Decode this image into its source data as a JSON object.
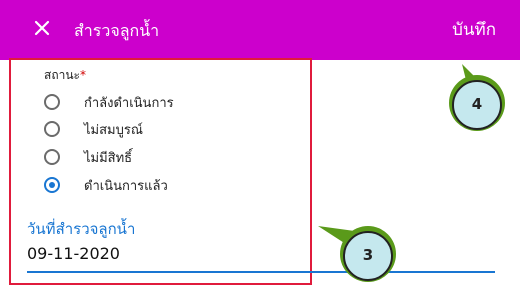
{
  "appbar": {
    "close_icon": "close-icon",
    "title": "สำรวจลูกน้ำ",
    "save_label": "บันทึก",
    "color": "#cc00cc"
  },
  "form": {
    "status": {
      "label": "สถานะ",
      "required_mark": "*",
      "options": [
        {
          "label": "กำลังดำเนินการ",
          "selected": false
        },
        {
          "label": "ไม่สมบูรณ์",
          "selected": false
        },
        {
          "label": "ไม่มีสิทธิ์",
          "selected": false
        },
        {
          "label": "ดำเนินการแล้ว",
          "selected": true
        }
      ]
    },
    "survey_date": {
      "label": "วันที่สำรวจลูกน้ำ",
      "value": "09-11-2020"
    }
  },
  "callouts": [
    {
      "number": "3"
    },
    {
      "number": "4"
    }
  ],
  "colors": {
    "accent": "#1976d2",
    "highlight": "#e01b3c",
    "callout_fill": "#c5e8ee",
    "callout_ring": "#5a9a1a"
  }
}
